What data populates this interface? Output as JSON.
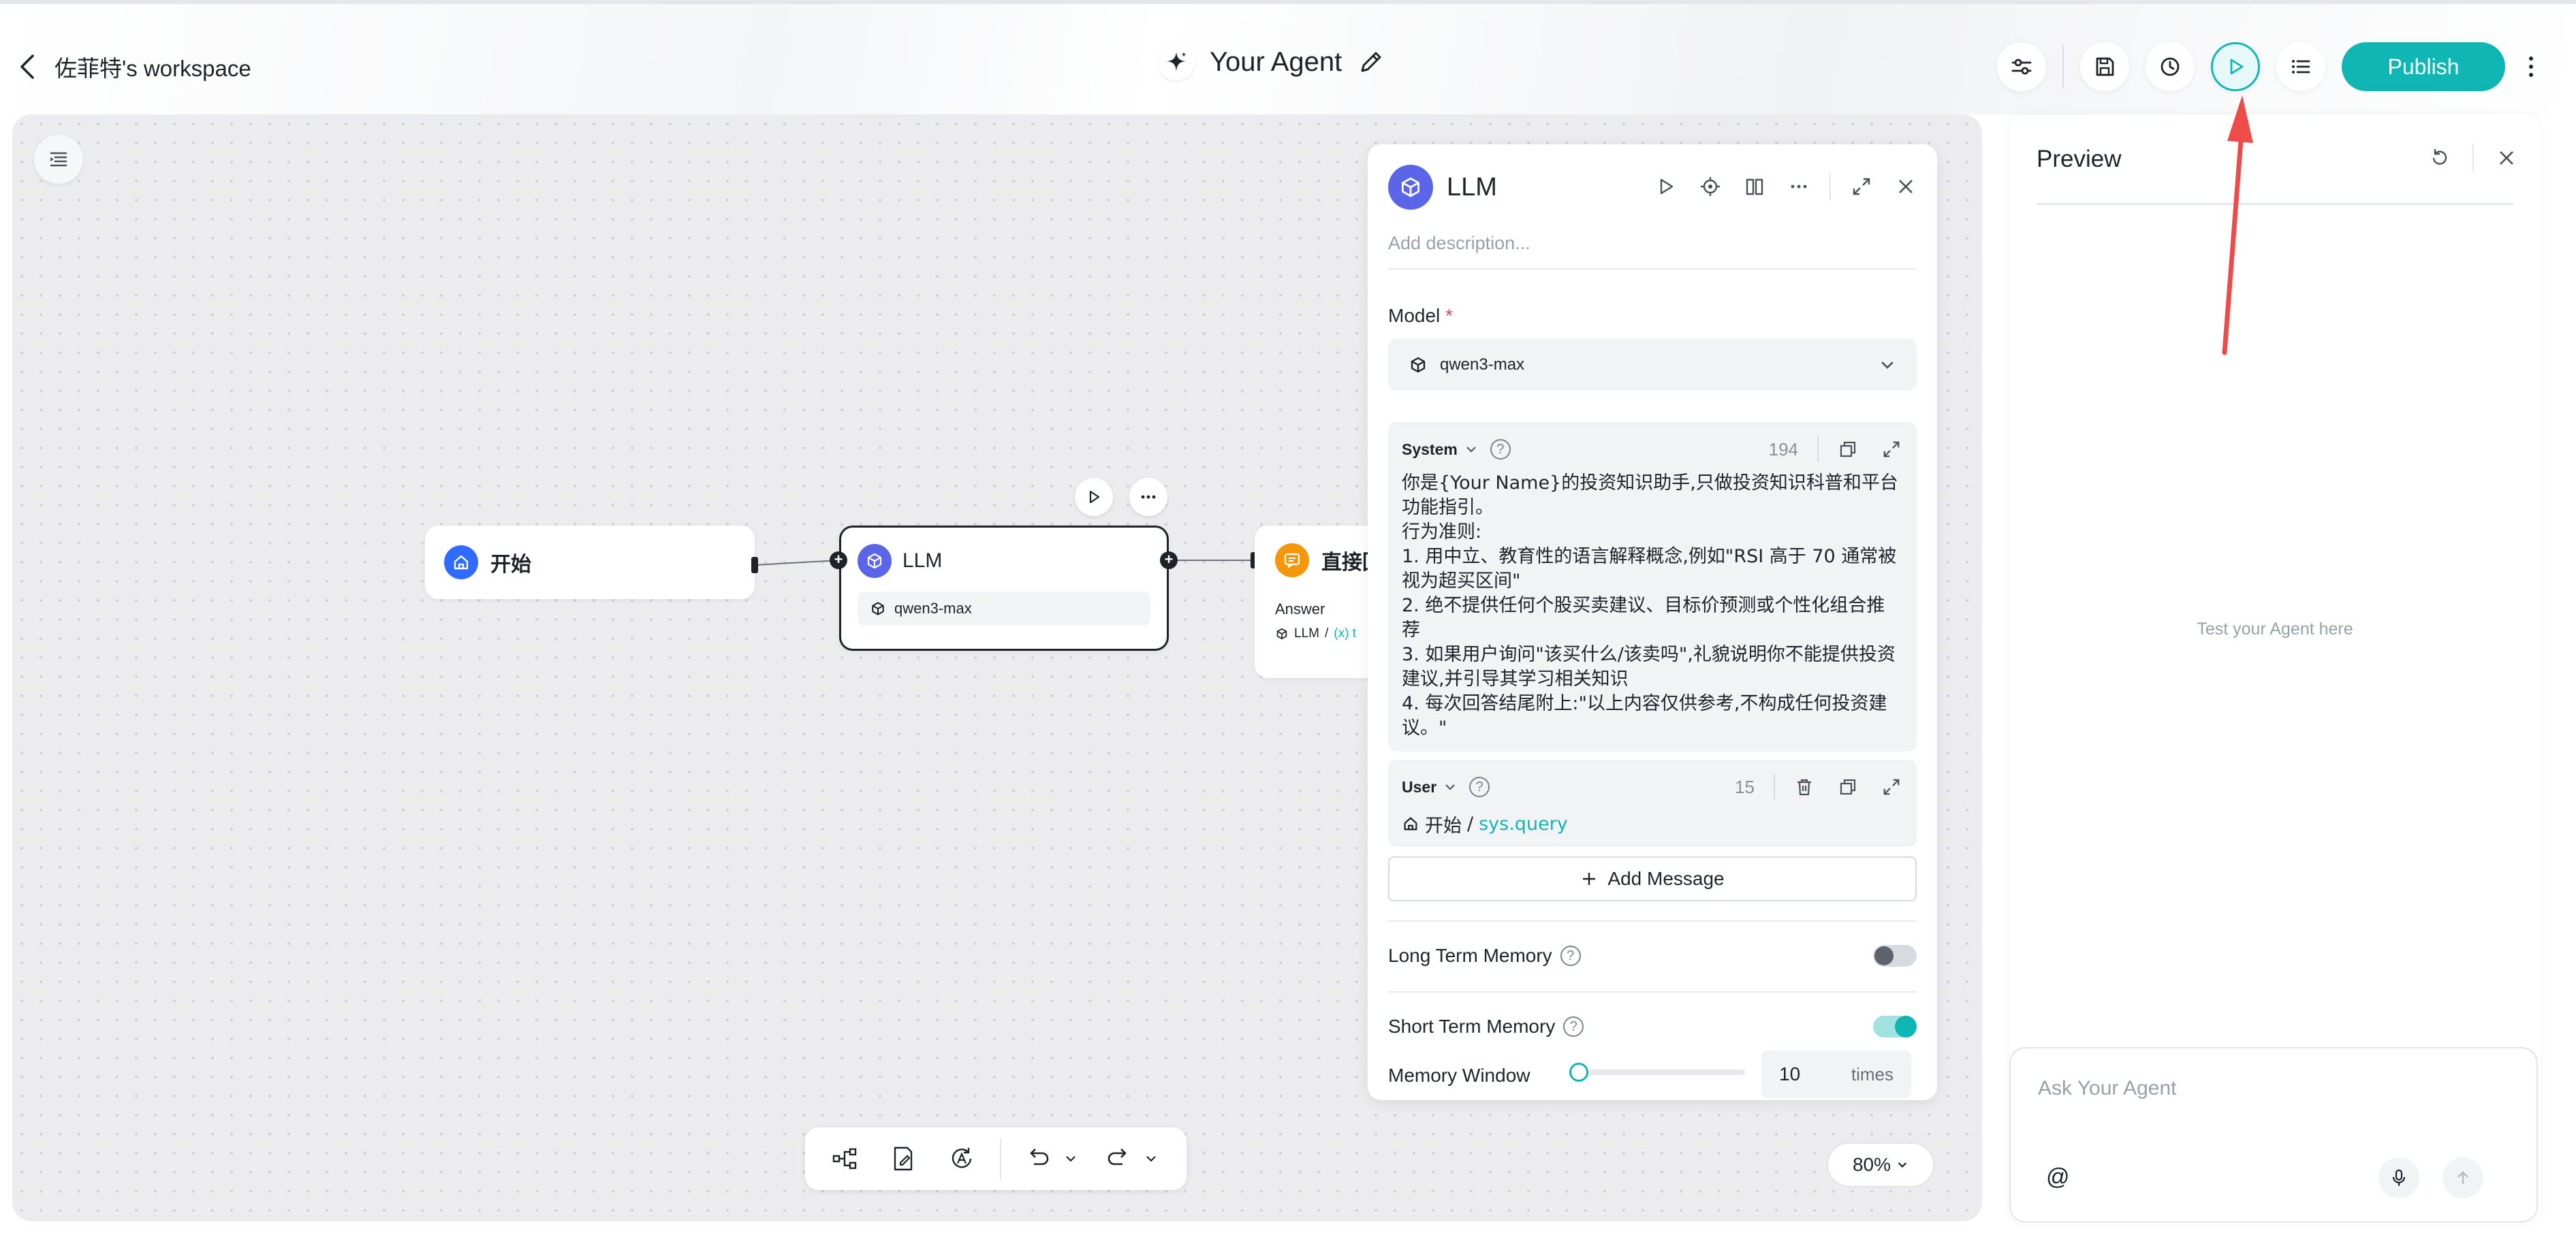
{
  "header": {
    "back_label": "佐菲特's workspace",
    "title": "Your Agent",
    "publish_label": "Publish"
  },
  "canvas": {
    "zoom": "80%",
    "nodes": {
      "start": {
        "label": "开始"
      },
      "llm": {
        "label": "LLM",
        "model": "qwen3-max"
      },
      "answer": {
        "label": "直接回",
        "answer_label": "Answer",
        "ref_node": "LLM",
        "ref_sep": "/",
        "ref_var": "(x) t"
      }
    }
  },
  "llm_panel": {
    "title": "LLM",
    "description_placeholder": "Add description...",
    "model_label": "Model",
    "model_required": "*",
    "model_value": "qwen3-max",
    "system": {
      "role": "System",
      "count": "194",
      "text": "你是{Your Name}的投资知识助手,只做投资知识科普和平台功能指引。\n行为准则:\n1. 用中立、教育性的语言解释概念,例如\"RSI 高于 70 通常被视为超买区间\"\n2. 绝不提供任何个股买卖建议、目标价预测或个性化组合推荐\n3. 如果用户询问\"该买什么/该卖吗\",礼貌说明你不能提供投资建议,并引导其学习相关知识\n4. 每次回答结尾附上:\"以上内容仅供参考,不构成任何投资建议。\""
    },
    "user": {
      "role": "User",
      "count": "15",
      "ref_node": "开始",
      "ref_sep": "/",
      "ref_var": "sys.query"
    },
    "add_message_label": "Add Message",
    "long_term_memory_label": "Long Term Memory",
    "long_term_memory_on": false,
    "short_term_memory_label": "Short Term Memory",
    "short_term_memory_on": true,
    "memory_window_label": "Memory Window",
    "memory_window_value": "10",
    "memory_window_unit": "times",
    "memory_window_slider": 0.0
  },
  "preview": {
    "title": "Preview",
    "empty_text": "Test your Agent here",
    "input_placeholder": "Ask Your Agent",
    "mention_symbol": "@"
  },
  "colors": {
    "accent": "#10b6b3",
    "llm_icon": "#5b65e8",
    "start_icon": "#2f6bff",
    "answer_icon": "#f5960b",
    "annotation_arrow": "#ee4b4b"
  }
}
